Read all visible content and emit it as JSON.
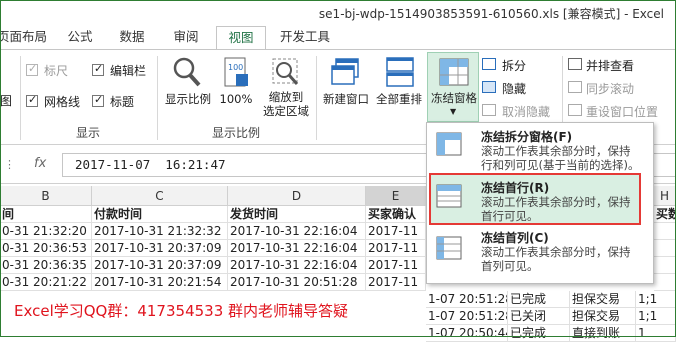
{
  "window": {
    "title": "se1-bj-wdp-1514903853591-610560.xls  [兼容模式] - Excel"
  },
  "tabs": [
    "页面布局",
    "公式",
    "数据",
    "审阅",
    "视图",
    "开发工具"
  ],
  "active_tab": "视图",
  "ribbon": {
    "show_group": {
      "label": "显示",
      "left_icon_label": "图",
      "checkboxes": [
        {
          "label": "标尺",
          "checked": true,
          "disabled": true
        },
        {
          "label": "编辑栏",
          "checked": true,
          "disabled": false
        },
        {
          "label": "网格线",
          "checked": true,
          "disabled": false
        },
        {
          "label": "标题",
          "checked": true,
          "disabled": false
        }
      ]
    },
    "zoom_group": {
      "label": "显示比例",
      "buttons": [
        {
          "label": "显示比例",
          "icon": "magnifier-icon"
        },
        {
          "label": "100%",
          "icon": "zoom-100-icon"
        },
        {
          "label": "缩放到\n选定区域",
          "icon": "zoom-selection-icon"
        }
      ]
    },
    "window_group": {
      "buttons": [
        {
          "label": "新建窗口",
          "icon": "new-window-icon"
        },
        {
          "label": "全部重排",
          "icon": "arrange-all-icon"
        },
        {
          "label": "冻结窗格",
          "icon": "freeze-panes-icon",
          "has_dropdown": true
        }
      ],
      "small_buttons": [
        {
          "label": "拆分",
          "disabled": false
        },
        {
          "label": "隐藏",
          "disabled": false
        },
        {
          "label": "取消隐藏",
          "disabled": true
        }
      ],
      "side_buttons": [
        {
          "label": "并排查看",
          "disabled": false
        },
        {
          "label": "同步滚动",
          "disabled": true
        },
        {
          "label": "重设窗口位置",
          "disabled": true
        }
      ]
    }
  },
  "formula_bar": {
    "value": "2017-11-07  16:21:47",
    "fx": "fx"
  },
  "freeze_menu": {
    "items": [
      {
        "title": "冻结拆分窗格(F)",
        "desc": [
          "滚动工作表其余部分时，保持",
          "行和列可见(基于当前的选择)。"
        ],
        "selected": false
      },
      {
        "title": "冻结首行(R)",
        "desc": [
          "滚动工作表其余部分时，保持",
          "首行可见。"
        ],
        "selected": true
      },
      {
        "title": "冻结首列(C)",
        "desc": [
          "滚动工作表其余部分时，保持",
          "首列可见。"
        ],
        "selected": false
      }
    ]
  },
  "sheet": {
    "columns": [
      "B",
      "C",
      "D",
      "E",
      "",
      "",
      "",
      "H"
    ],
    "header_row": [
      "间",
      "付款时间",
      "发货时间",
      "买家确认",
      "",
      "",
      "",
      "买数"
    ],
    "rows": [
      [
        "0-31 21:32:20",
        "2017-10-31 21:32:32",
        "2017-10-31 22:16:04",
        "2017-11",
        "",
        "",
        "",
        ""
      ],
      [
        "0-31 20:36:53",
        "2017-10-31 20:37:09",
        "2017-10-31 22:16:04",
        "2017-11",
        "",
        "",
        "",
        ""
      ],
      [
        "0-31 20:36:35",
        "2017-10-31 20:37:09",
        "2017-10-31 22:16:04",
        "2017-11",
        "",
        "",
        "",
        ""
      ],
      [
        "0-31 20:21:22",
        "2017-10-31 20:21:54",
        "2017-10-31 20:51:28",
        "2017-11",
        "",
        "",
        "",
        ""
      ],
      [
        "",
        "",
        "",
        "1-07 20:51:28",
        "已完成",
        "担保交易",
        "1;1",
        ""
      ],
      [
        "",
        "",
        "",
        "1-07 20:51:28",
        "已关闭",
        "担保交易",
        "1;1",
        ""
      ],
      [
        "",
        "",
        "",
        "1-07 20:50:44",
        "已完成",
        "直接到账",
        "1",
        ""
      ],
      [
        "",
        "",
        "",
        "1-07 20:50:44",
        "已关闭",
        "直接到账",
        "1",
        ""
      ]
    ]
  },
  "watermark": "Excel学习QQ群：417354533  群内老师辅导答疑",
  "colors": {
    "accent": "#217346",
    "highlight": "#d9efe2",
    "selected_border": "#e53935"
  }
}
